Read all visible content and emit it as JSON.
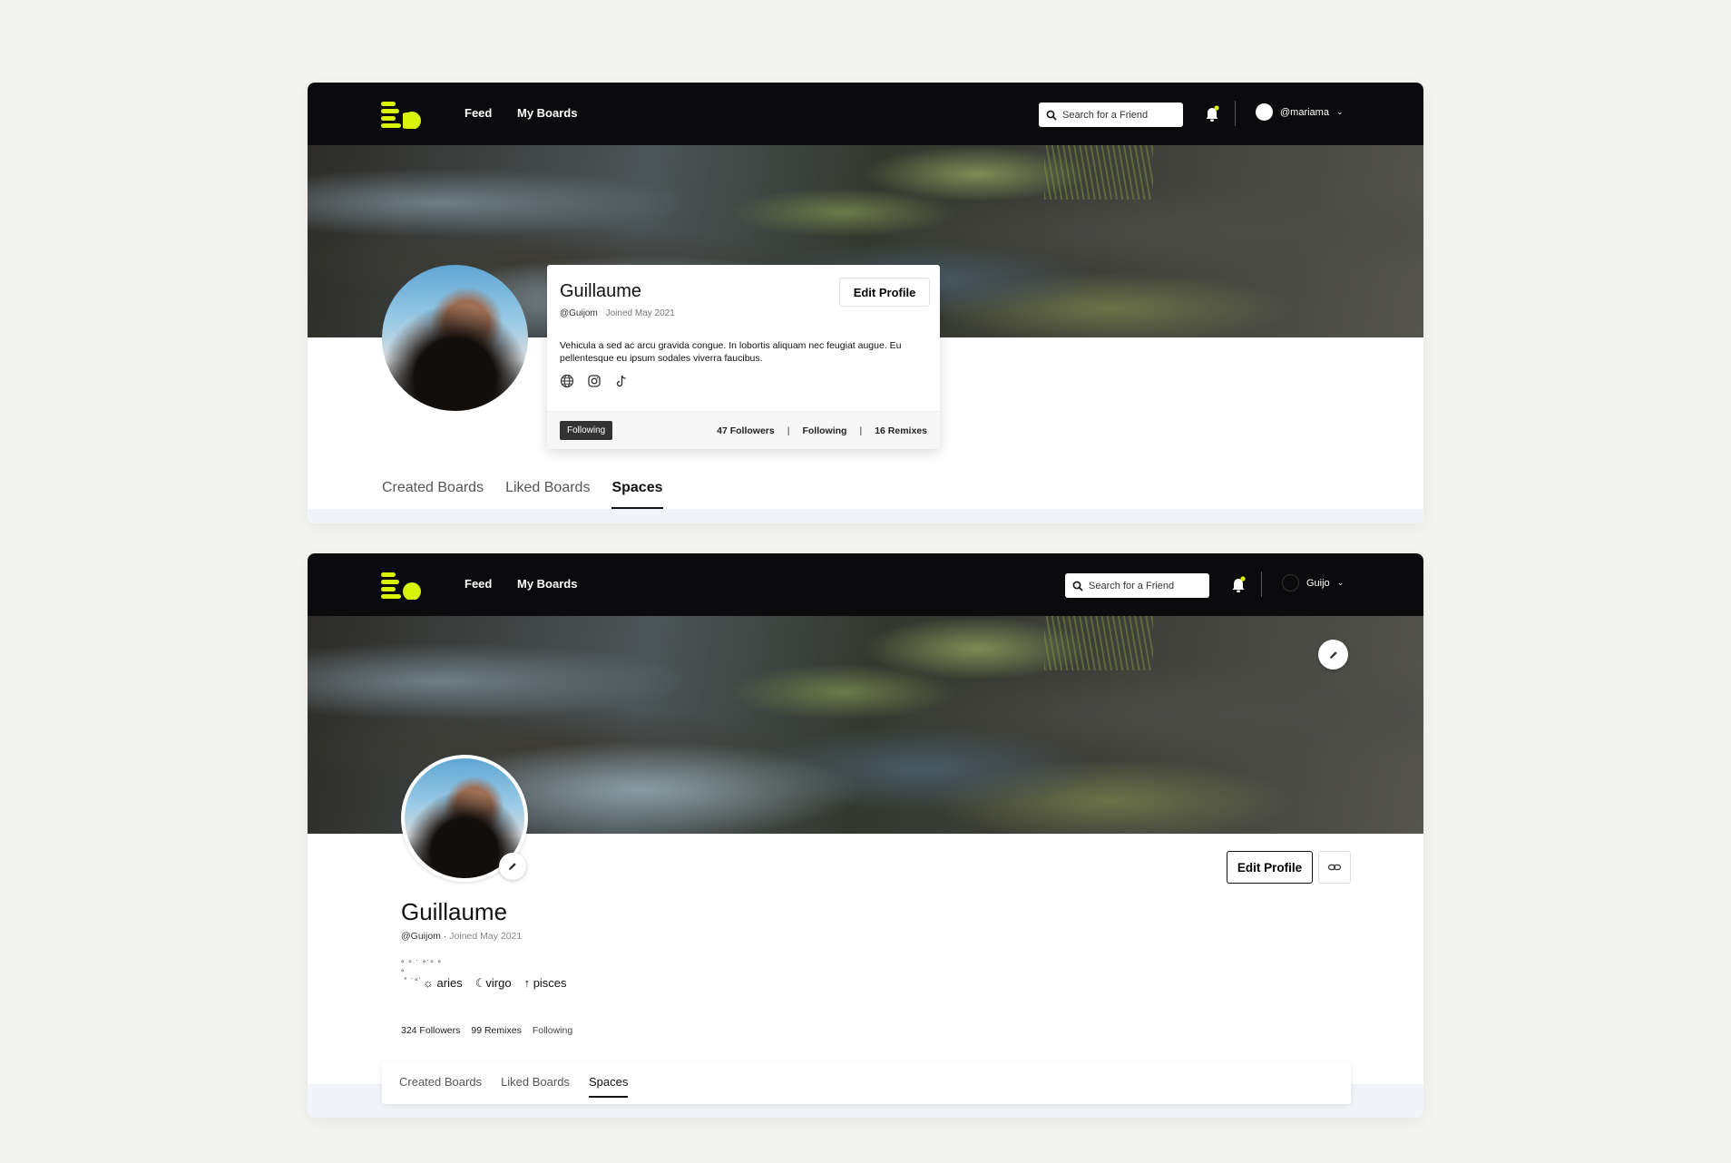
{
  "colors": {
    "brand": "#d9f20a",
    "nav_bg": "#0b0b0d",
    "accent_dark": "#111111"
  },
  "frame1": {
    "nav": {
      "feed": "Feed",
      "boards": "My Boards",
      "search_placeholder": "Search for a Friend",
      "username": "@mariama"
    },
    "profile": {
      "name": "Guillaume",
      "handle": "@Guijom",
      "joined": "Joined May 2021",
      "bio": "Vehicula a sed ac arcu gravida congue. In lobortis aliquam nec feugiat augue. Eu pellentesque eu ipsum sodales viverra faucibus.",
      "socials": [
        "globe-icon",
        "instagram-icon",
        "tiktok-icon"
      ],
      "edit_label": "Edit Profile",
      "following_badge": "Following",
      "followers": "47 Followers",
      "following": "Following",
      "remixes": "16 Remixes"
    },
    "tabs": [
      "Created Boards",
      "Liked Boards",
      "Spaces"
    ],
    "active_tab": "Spaces"
  },
  "frame2": {
    "nav": {
      "feed": "Feed",
      "boards": "My Boards",
      "search_placeholder": "Search for a Friend",
      "username": "Guijo"
    },
    "profile": {
      "name": "Guillaume",
      "handle": "@Guijom",
      "sep": "·",
      "joined": "Joined May 2021",
      "sun": "aries",
      "moon": "virgo",
      "rising": "pisces",
      "followers": "324 Followers",
      "remixes": "99 Remixes",
      "following": "Following",
      "edit_label": "Edit Profile"
    },
    "tabs": [
      "Created Boards",
      "Liked Boards",
      "Spaces"
    ],
    "active_tab": "Spaces"
  }
}
